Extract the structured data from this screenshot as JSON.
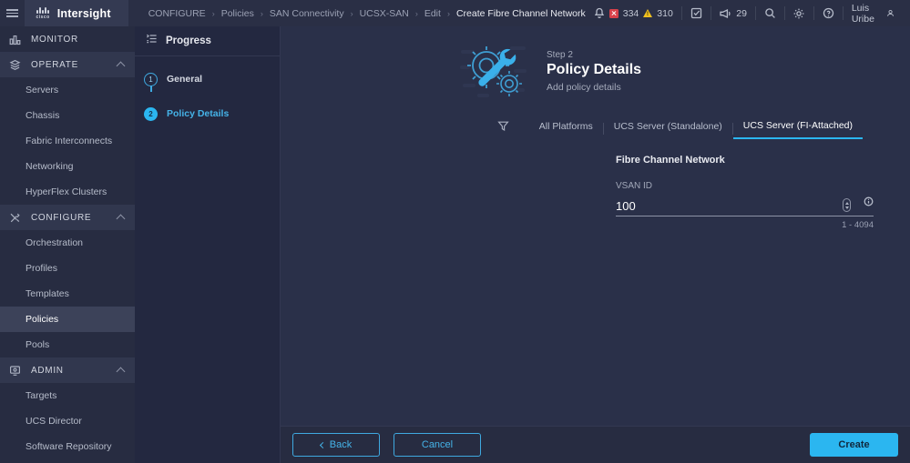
{
  "brand": {
    "cisco": "cisco",
    "name": "Intersight"
  },
  "breadcrumb": [
    {
      "label": "CONFIGURE"
    },
    {
      "label": "Policies"
    },
    {
      "label": "SAN Connectivity"
    },
    {
      "label": "UCSX-SAN"
    },
    {
      "label": "Edit"
    },
    {
      "label": "Create Fibre Channel Network"
    }
  ],
  "topbar": {
    "critical_count": "334",
    "warning_count": "310",
    "announcement_count": "29",
    "user_name": "Luis Uribe",
    "icons": {
      "hamburger": "hamburger-icon",
      "bell": "bell-icon",
      "critical": "critical-alarm-icon",
      "warning": "warning-alarm-icon",
      "checklist": "checklist-icon",
      "megaphone": "megaphone-icon",
      "search": "search-icon",
      "gear": "gear-icon",
      "help": "help-icon",
      "avatar": "user-avatar-icon"
    }
  },
  "sidebar": {
    "groups": [
      {
        "label": "MONITOR",
        "icon": "monitor-chart-icon",
        "expandable": false,
        "items": []
      },
      {
        "label": "OPERATE",
        "icon": "operate-stack-icon",
        "expandable": true,
        "items": [
          "Servers",
          "Chassis",
          "Fabric Interconnects",
          "Networking",
          "HyperFlex Clusters"
        ]
      },
      {
        "label": "CONFIGURE",
        "icon": "configure-tools-icon",
        "expandable": true,
        "items": [
          "Orchestration",
          "Profiles",
          "Templates",
          "Policies",
          "Pools"
        ]
      },
      {
        "label": "ADMIN",
        "icon": "admin-screen-icon",
        "expandable": true,
        "items": [
          "Targets",
          "UCS Director",
          "Software Repository"
        ]
      }
    ],
    "active_item": "Policies"
  },
  "progress": {
    "title": "Progress",
    "steps": [
      {
        "number": "1",
        "label": "General",
        "state": "todo"
      },
      {
        "number": "2",
        "label": "Policy Details",
        "state": "current"
      }
    ]
  },
  "hero": {
    "step_label": "Step 2",
    "title": "Policy Details",
    "subtitle": "Add policy details"
  },
  "platform_tabs": {
    "filter_icon": "filter-funnel-icon",
    "tabs": [
      {
        "label": "All Platforms",
        "selected": false
      },
      {
        "label": "UCS Server (Standalone)",
        "selected": false
      },
      {
        "label": "UCS Server (FI-Attached)",
        "selected": true
      }
    ]
  },
  "form": {
    "section_title": "Fibre Channel Network",
    "vsan": {
      "label": "VSAN ID",
      "value": "100",
      "placeholder": "",
      "hint": "1 - 4094",
      "info_icon": "info-circle-icon",
      "stepper_icon": "number-stepper-icon"
    }
  },
  "footer": {
    "back_label": "Back",
    "cancel_label": "Cancel",
    "create_label": "Create"
  },
  "colors": {
    "accent": "#2bb6f0",
    "critical": "#d9414a",
    "warning": "#f0c020",
    "main_bg": "#2a3049",
    "sidebar_bg": "#272c41"
  }
}
